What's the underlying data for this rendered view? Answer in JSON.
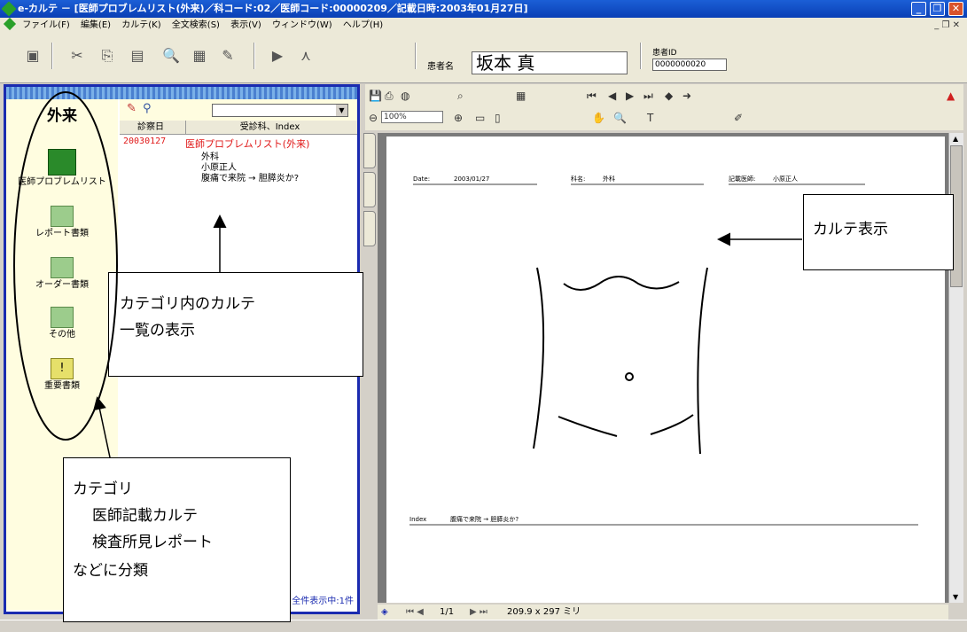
{
  "window": {
    "title": "e-カルテ － [医師プロブレムリスト(外来)／科コード:02／医師コード:00000209／記載日時:2003年01月27日]"
  },
  "menu": [
    "ファイル(F)",
    "編集(E)",
    "カルテ(K)",
    "全文検索(S)",
    "表示(V)",
    "ウィンドウ(W)",
    "ヘルプ(H)"
  ],
  "patient": {
    "label": "患者名",
    "name": "坂本 真",
    "id_label": "患者ID",
    "id": "0000000020"
  },
  "categories": {
    "header": "外来",
    "items": [
      {
        "label": "医師プロブレムリスト",
        "icon": "folder-green-dark"
      },
      {
        "label": "レポート書類",
        "icon": "folder-green"
      },
      {
        "label": "オーダー書類",
        "icon": "folder-green"
      },
      {
        "label": "その他",
        "icon": "folder-green"
      },
      {
        "label": "重要書類",
        "icon": "folder-yellow"
      }
    ]
  },
  "list": {
    "columns": [
      "診察日",
      "受診科、Index"
    ],
    "rows": [
      {
        "date": "20030127",
        "title": "医師プロブレムリスト(外来)",
        "dept": "外科",
        "doctor": "小原正人",
        "index": "腹痛で来院 → 胆膵炎か?"
      }
    ],
    "status": "全件表示中:1件"
  },
  "viewer": {
    "zoom": "100%",
    "page": "1/1",
    "page_size": "209.9 x 297 ミリ"
  },
  "document": {
    "date_label": "Date:",
    "date": "2003/01/27",
    "dept_label": "科名:",
    "dept": "外科",
    "doctor_label": "記載医師:",
    "doctor": "小原正人",
    "index_label": "Index",
    "index": "腹痛で来院 → 胆膵炎か?"
  },
  "callouts": {
    "karte": "カルテ表示",
    "list": [
      "カテゴリ内のカルテ",
      "一覧の表示"
    ],
    "category": [
      "カテゴリ",
      "医師記載カルテ",
      "検査所見レポート",
      "などに分類"
    ]
  },
  "colors": {
    "accent": "#1a2bb0",
    "record": "#e01818",
    "title": "#0a3fb5"
  }
}
